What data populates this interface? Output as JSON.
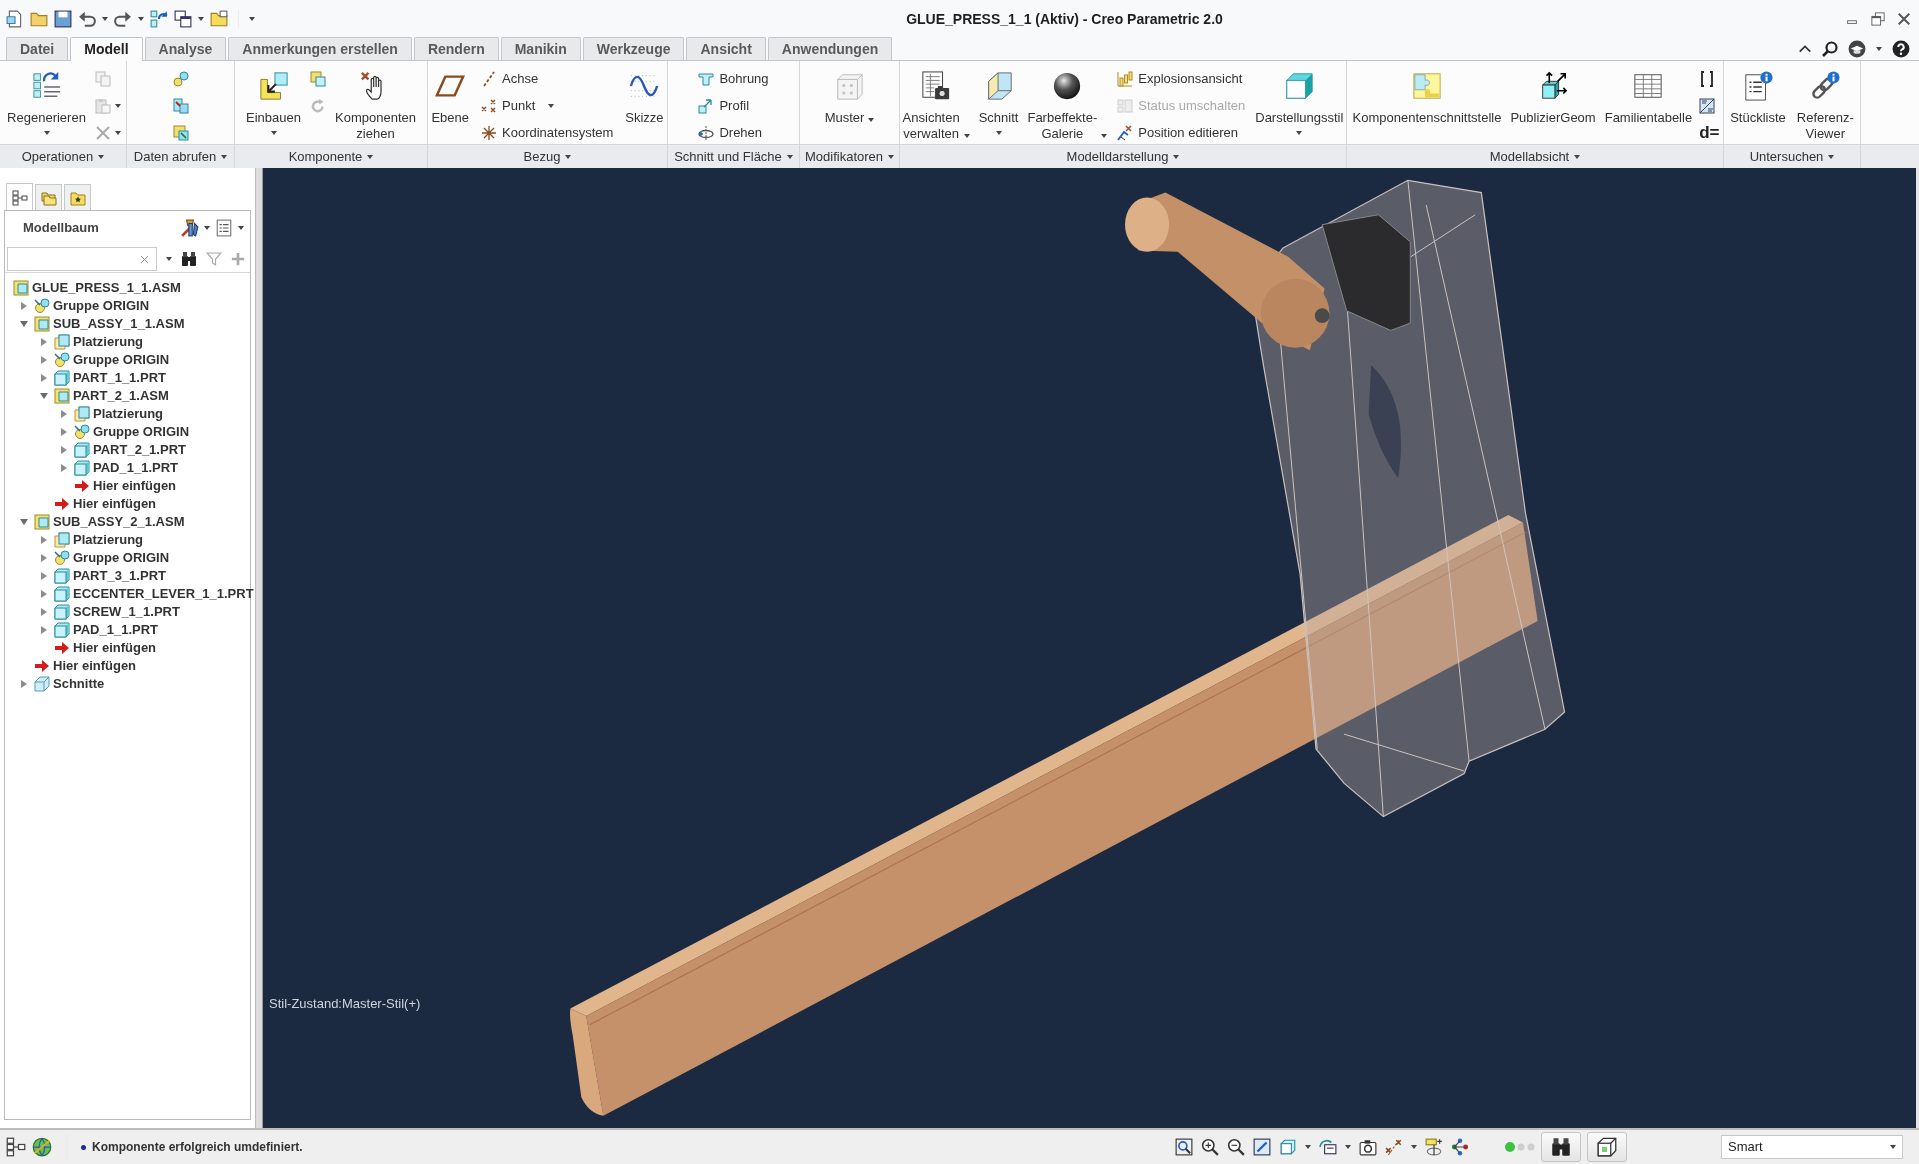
{
  "window": {
    "title": "GLUE_PRESS_1_1 (Aktiv) - Creo Parametric 2.0"
  },
  "tabs": [
    {
      "label": "Datei",
      "selected": false
    },
    {
      "label": "Modell",
      "selected": true
    },
    {
      "label": "Analyse",
      "selected": false
    },
    {
      "label": "Anmerkungen erstellen",
      "selected": false
    },
    {
      "label": "Rendern",
      "selected": false
    },
    {
      "label": "Manikin",
      "selected": false
    },
    {
      "label": "Werkzeuge",
      "selected": false
    },
    {
      "label": "Ansicht",
      "selected": false
    },
    {
      "label": "Anwendungen",
      "selected": false
    }
  ],
  "ribbon": [
    {
      "label": "Operationen",
      "items": [
        {
          "kind": "large",
          "label": "Regenerieren",
          "dropdown": true
        },
        {
          "kind": "icon_stack"
        }
      ]
    },
    {
      "label": "Daten abrufen",
      "items": [
        {
          "kind": "icon_stack"
        }
      ]
    },
    {
      "label": "Komponente",
      "items": [
        {
          "kind": "large",
          "label": "Einbauen",
          "dropdown": true
        },
        {
          "kind": "icon_stack"
        },
        {
          "kind": "large",
          "label": "Komponenten ziehen"
        }
      ]
    },
    {
      "label": "Bezug",
      "items": [
        {
          "kind": "large",
          "label": "Ebene"
        },
        {
          "kind": "stack",
          "rows": [
            {
              "label": "Achse",
              "disabled": false
            },
            {
              "label": "Punkt",
              "disabled": false,
              "dropdown": true
            },
            {
              "label": "Koordinatensystem",
              "disabled": false
            }
          ]
        },
        {
          "kind": "large",
          "label": "Skizze"
        }
      ]
    },
    {
      "label": "Schnitt und Fläche",
      "items": [
        {
          "kind": "stack",
          "rows": [
            {
              "label": "Bohrung",
              "disabled": false
            },
            {
              "label": "Profil",
              "disabled": false
            },
            {
              "label": "Drehen",
              "disabled": false
            }
          ]
        }
      ]
    },
    {
      "label": "Modifikatoren",
      "items": [
        {
          "kind": "menu",
          "label": "Muster"
        }
      ]
    },
    {
      "label": "Modelldarstellung",
      "items": [
        {
          "kind": "menu",
          "label": "Ansichten verwalten"
        },
        {
          "kind": "large",
          "label": "Schnitt",
          "dropdown": true
        },
        {
          "kind": "menu",
          "label": "Farbeffekte-Galerie"
        },
        {
          "kind": "stack",
          "rows": [
            {
              "label": "Explosionsansicht",
              "disabled": false
            },
            {
              "label": "Status umschalten",
              "disabled": true
            },
            {
              "label": "Position editieren",
              "disabled": false
            }
          ]
        },
        {
          "kind": "large",
          "label": "Darstellungsstil",
          "dropdown": true
        }
      ]
    },
    {
      "label": "Modellabsicht",
      "items": [
        {
          "kind": "large",
          "label": "Komponentenschnittstelle"
        },
        {
          "kind": "large",
          "label": "PublizierGeom"
        },
        {
          "kind": "large",
          "label": "Familientabelle"
        },
        {
          "kind": "icon_stack",
          "label": "d="
        }
      ]
    },
    {
      "label": "Untersuchen",
      "items": [
        {
          "kind": "large",
          "label": "Stückliste"
        },
        {
          "kind": "large",
          "label": "Referenz-Viewer"
        }
      ]
    }
  ],
  "model_tree": {
    "tabs": [
      {
        "selected": true
      },
      {
        "selected": false
      },
      {
        "selected": false
      }
    ],
    "title": "Modellbaum",
    "items": [
      {
        "kind": "assembly",
        "label": "GLUE_PRESS_1_1.ASM",
        "children": [
          {
            "kind": "group",
            "label": "Gruppe ORIGIN",
            "expanded": false
          },
          {
            "kind": "assembly",
            "label": "SUB_ASSY_1_1.ASM",
            "expanded": true,
            "children": [
              {
                "kind": "placement",
                "label": "Platzierung",
                "expanded": false
              },
              {
                "kind": "group",
                "label": "Gruppe ORIGIN",
                "expanded": false
              },
              {
                "kind": "part",
                "label": "PART_1_1.PRT",
                "expanded": false
              },
              {
                "kind": "assembly",
                "label": "PART_2_1.ASM",
                "expanded": true,
                "children": [
                  {
                    "kind": "placement",
                    "label": "Platzierung",
                    "expanded": false
                  },
                  {
                    "kind": "group",
                    "label": "Gruppe ORIGIN",
                    "expanded": false
                  },
                  {
                    "kind": "part",
                    "label": "PART_2_1.PRT",
                    "expanded": false
                  },
                  {
                    "kind": "part",
                    "label": "PAD_1_1.PRT",
                    "expanded": false
                  },
                  {
                    "kind": "insert",
                    "label": "Hier einfügen"
                  }
                ]
              },
              {
                "kind": "insert",
                "label": "Hier einfügen"
              }
            ]
          },
          {
            "kind": "assembly",
            "label": "SUB_ASSY_2_1.ASM",
            "expanded": true,
            "children": [
              {
                "kind": "placement",
                "label": "Platzierung",
                "expanded": false
              },
              {
                "kind": "group",
                "label": "Gruppe ORIGIN",
                "expanded": false
              },
              {
                "kind": "part",
                "label": "PART_3_1.PRT",
                "expanded": false
              },
              {
                "kind": "part",
                "label": "ECCENTER_LEVER_1_1.PRT",
                "expanded": false
              },
              {
                "kind": "part",
                "label": "SCREW_1_1.PRT",
                "expanded": false
              },
              {
                "kind": "part",
                "label": "PAD_1_1.PRT",
                "expanded": false
              },
              {
                "kind": "insert",
                "label": "Hier einfügen"
              }
            ]
          },
          {
            "kind": "insert",
            "label": "Hier einfügen"
          },
          {
            "kind": "sections",
            "label": "Schnitte",
            "expanded": false
          }
        ]
      }
    ]
  },
  "viewport": {
    "style_state": "Stil-Zustand:Master-Stil(+)"
  },
  "status_bar": {
    "message": "Komponente erfolgreich umdefiniert.",
    "selection_filter": "Smart"
  }
}
